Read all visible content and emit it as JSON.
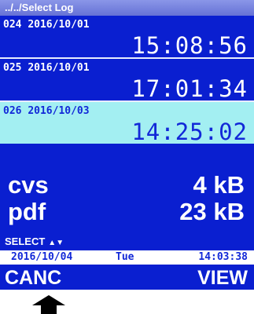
{
  "path_bar": {
    "text": "../../Select Log"
  },
  "logs": [
    {
      "number": "024",
      "date": "2016/10/01",
      "time": "15:08:56",
      "selected": false
    },
    {
      "number": "025",
      "date": "2016/10/01",
      "time": "17:01:34",
      "selected": false
    },
    {
      "number": "026",
      "date": "2016/10/03",
      "time": "14:25:02",
      "selected": true
    }
  ],
  "files": [
    {
      "type": "cvs",
      "size": "4 kB"
    },
    {
      "type": "pdf",
      "size": "23 kB"
    }
  ],
  "select_hint": {
    "label": "SELECT",
    "arrows": "▲▼"
  },
  "status": {
    "date": "2016/10/04",
    "day": "Tue",
    "time": "14:03:38"
  },
  "softkeys": {
    "left": "CANC",
    "right": "VIEW"
  },
  "colors": {
    "screen_bg": "#0a1fd0",
    "selected_bg": "#a3eff2",
    "text_light": "#ffffff",
    "text_dark": "#1228d8"
  },
  "icons": {
    "pointer": "up-arrow-icon"
  }
}
